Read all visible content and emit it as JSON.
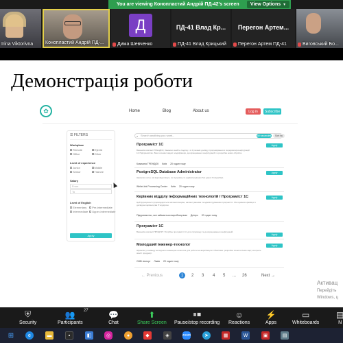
{
  "banner": {
    "text": "You are viewing Конопластий Андрій ПД-42's screen",
    "view_options": "View Options"
  },
  "participants": [
    {
      "name": "Irina Viktorivna"
    },
    {
      "name": "Конопластий Андрій ПД-..."
    },
    {
      "name": "Дима Шевченко",
      "avatar_letter": "Д",
      "avatar_color": "#7a3fc4"
    },
    {
      "name": "ПД-41 Влад Крицький",
      "big": "ПД-41 Влад Кр..."
    },
    {
      "name": "Перегон Артем ПД-41",
      "big": "Перегон Артем..."
    },
    {
      "name": "Виговський Бо..."
    }
  ],
  "slide": {
    "title": "Демонстрація роботи"
  },
  "site": {
    "nav": {
      "home": "Home",
      "blog": "Blog",
      "about": "About us",
      "login": "Log in",
      "subscribe": "Subscribe"
    },
    "filters": {
      "header": "FILTERS",
      "workplace_label": "Workplace",
      "workplace_opts": [
        "Remote",
        "Hybrid",
        "Office",
        "Other"
      ],
      "experience_label": "Level of experience",
      "experience_opts": [
        "Junior",
        "Middle",
        "Senior",
        "Trainee"
      ],
      "salary_label": "Salary",
      "salary_from": "From",
      "salary_to": "To",
      "english_label": "Level of English",
      "english_opts": [
        "Elementary",
        "Pre-intermediate",
        "Intermediate",
        "Upper-intermediate"
      ],
      "apply": "Apply"
    },
    "search": {
      "placeholder": "Search anything you want...",
      "chip1": "All vacancies",
      "chip2": "Sort by"
    },
    "jobs": [
      {
        "title": "Програміст 1С",
        "desc": "Вакансія компанії ТРЕНДОК, бажаємо знайти людину з 2-3 роками досвіду програмування в середовищі конфігурацій 1С:Підприємство. Ваші основні задачі: модифікація, доопрацювання конфігурацій та розробка нових обробок.",
        "company": "Компанія ТРЕНДОК",
        "city": "Київ",
        "age": "20 годин тому",
        "tag": "Apply"
      },
      {
        "title": "PostgreSQL Database Administrator",
        "desc": "Шукаємо колег, які відповідатимуть за підтримку та адміністрування баз даних PostgreSQL.",
        "company": "WhiteLink Processing Center",
        "city": "Київ",
        "age": "20 годин тому",
        "tag": "Apply"
      },
      {
        "title": "Керівник відділу інформаційних технологій / Програміст 1С",
        "desc": "Цей функціонал супроводжується автоматизацією, налаштуванням та адмініструванням програм 1С. Ми шукаємо фахівця з досвідом керівництва ІТ-відділом.",
        "company": "Підприємство, яке займається виробництвом",
        "city": "Дніпро",
        "age": "20 годин тому",
        "tag": "Apply"
      },
      {
        "title": "Програміст 1С",
        "desc": "Вакансія компанії ПРОДУКТ. Потрібен програміст 1С для супроводу та доопрацювання конфігурацій.",
        "company": "",
        "city": "",
        "age": "",
        "tag": "Apply"
      },
      {
        "title": "Молодший інженер-технолог",
        "desc": "Шукаємо у команду молодшого інженера-технолога для роботи на виробництві. Обов'язки: розробка технологічних карт, контроль якості продукції.",
        "company": "СМВ хімторг",
        "city": "Львів",
        "age": "20 годин тому",
        "tag": "Apply"
      }
    ],
    "pagination": {
      "prev": "← Previous",
      "pages": [
        "1",
        "2",
        "3",
        "4",
        "5",
        "...",
        "26"
      ],
      "next": "Next →"
    },
    "activate": {
      "line1": "Активац",
      "line2": "Перейдіть",
      "line3": "Windows, ц"
    }
  },
  "toolbar": {
    "security": "Security",
    "participants": "Participants",
    "participants_count": "27",
    "chat": "Chat",
    "share": "Share Screen",
    "pause": "Pause/stop recording",
    "reactions": "Reactions",
    "apps": "Apps",
    "whiteboards": "Whiteboards",
    "notes": "N"
  },
  "colors": {
    "banner_green": "#2e9e4f",
    "accent_teal": "#2ec4c6",
    "page_blue": "#2f86d6",
    "zoom_green": "#3ccf5d"
  }
}
